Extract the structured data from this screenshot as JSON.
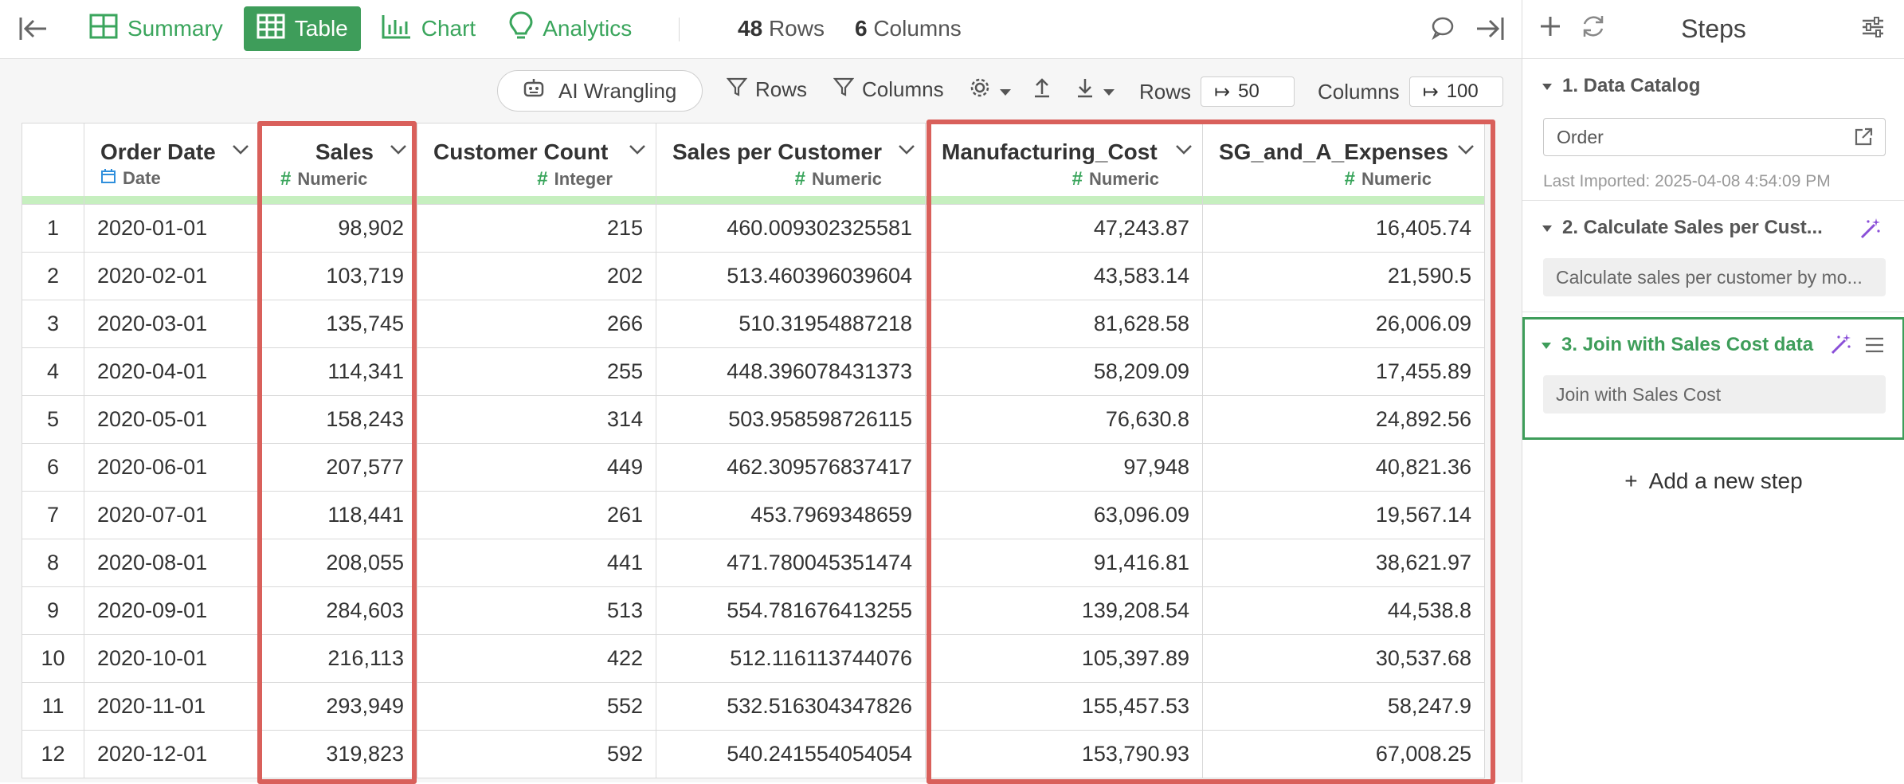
{
  "topbar": {
    "tabs": [
      {
        "label": "Summary",
        "icon": "summary-grid-icon",
        "active": false
      },
      {
        "label": "Table",
        "icon": "table-icon",
        "active": true
      },
      {
        "label": "Chart",
        "icon": "chart-icon",
        "active": false
      },
      {
        "label": "Analytics",
        "icon": "lightbulb-icon",
        "active": false
      }
    ],
    "rows_count": "48",
    "rows_label": "Rows",
    "cols_count": "6",
    "cols_label": "Columns"
  },
  "toolbar": {
    "ai_label": "AI Wrangling",
    "rows_filter": "Rows",
    "columns_filter": "Columns",
    "rows_limit_label": "Rows",
    "rows_limit_value": "50",
    "columns_limit_label": "Columns",
    "columns_limit_value": "100"
  },
  "grid": {
    "columns": [
      {
        "name": "Order Date",
        "type": "Date"
      },
      {
        "name": "Sales",
        "type": "Numeric"
      },
      {
        "name": "Customer Count",
        "type": "Integer"
      },
      {
        "name": "Sales per Customer",
        "type": "Numeric"
      },
      {
        "name": "Manufacturing_Cost",
        "type": "Numeric"
      },
      {
        "name": "SG_and_A_Expenses",
        "type": "Numeric"
      }
    ],
    "rows": [
      [
        "1",
        "2020-01-01",
        "98,902",
        "215",
        "460.009302325581",
        "47,243.87",
        "16,405.74"
      ],
      [
        "2",
        "2020-02-01",
        "103,719",
        "202",
        "513.460396039604",
        "43,583.14",
        "21,590.5"
      ],
      [
        "3",
        "2020-03-01",
        "135,745",
        "266",
        "510.31954887218",
        "81,628.58",
        "26,006.09"
      ],
      [
        "4",
        "2020-04-01",
        "114,341",
        "255",
        "448.396078431373",
        "58,209.09",
        "17,455.89"
      ],
      [
        "5",
        "2020-05-01",
        "158,243",
        "314",
        "503.958598726115",
        "76,630.8",
        "24,892.56"
      ],
      [
        "6",
        "2020-06-01",
        "207,577",
        "449",
        "462.309576837417",
        "97,948",
        "40,821.36"
      ],
      [
        "7",
        "2020-07-01",
        "118,441",
        "261",
        "453.7969348659",
        "63,096.09",
        "19,567.14"
      ],
      [
        "8",
        "2020-08-01",
        "208,055",
        "441",
        "471.780045351474",
        "91,416.81",
        "38,621.97"
      ],
      [
        "9",
        "2020-09-01",
        "284,603",
        "513",
        "554.781676413255",
        "139,208.54",
        "44,538.8"
      ],
      [
        "10",
        "2020-10-01",
        "216,113",
        "422",
        "512.116113744076",
        "105,397.89",
        "30,537.68"
      ],
      [
        "11",
        "2020-11-01",
        "293,949",
        "552",
        "532.516304347826",
        "155,457.53",
        "58,247.9"
      ],
      [
        "12",
        "2020-12-01",
        "319,823",
        "592",
        "540.241554054054",
        "153,790.93",
        "67,008.25"
      ]
    ]
  },
  "steps": {
    "title": "Steps",
    "items": [
      {
        "title": "1. Data Catalog",
        "input": "Order",
        "meta": "Last Imported: 2025-04-08 4:54:09 PM"
      },
      {
        "title": "2. Calculate Sales per Cust...",
        "desc": "Calculate sales per customer by mo..."
      },
      {
        "title": "3. Join with Sales Cost data",
        "desc": "Join with Sales Cost"
      }
    ],
    "add_label": "Add a new step"
  },
  "colors": {
    "accent_green": "#3e9d5a",
    "highlight_red": "#d9605b",
    "ai_purple": "#8a4fd8",
    "type_bar": "#c6efbf"
  }
}
